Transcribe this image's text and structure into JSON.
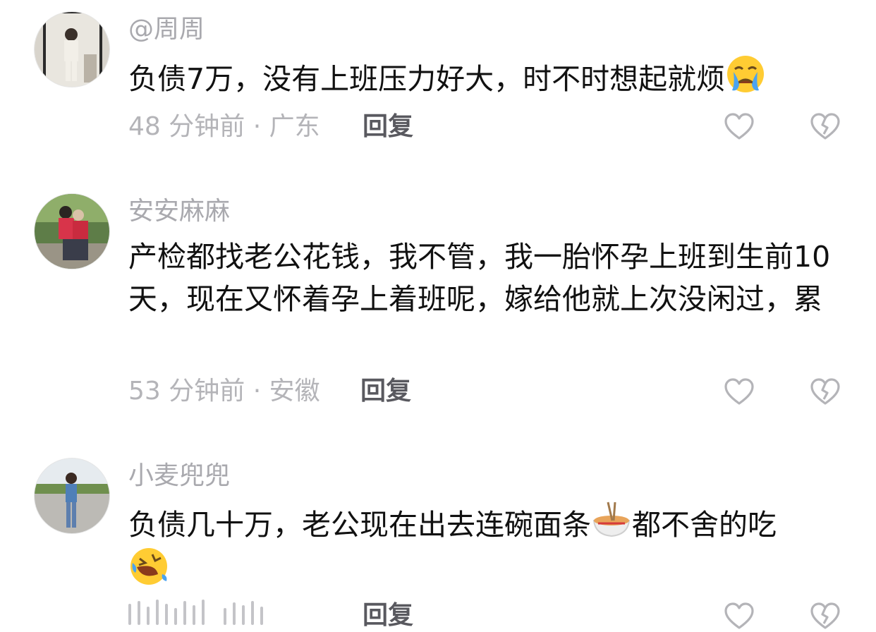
{
  "comments": [
    {
      "username": "@周周",
      "text": "负债7万，没有上班压力好大，时不时想起就烦",
      "emoji": "crying-face-icon",
      "time": "48 分钟前",
      "location": "广东",
      "reply_label": "回复"
    },
    {
      "username": "安安麻麻",
      "text": "产检都找老公花钱，我不管，我一胎怀孕上班到生前10天，现在又怀着孕上着班呢，嫁给他就上次没闲过，累",
      "time": "53 分钟前",
      "location": "安徽",
      "reply_label": "回复"
    },
    {
      "username": "小麦兜兜",
      "text_part1": "负债几十万，老公现在出去连碗面条",
      "text_part2": "都不舍的吃",
      "emoji_inline": "noodle-bowl-icon",
      "emoji_end": "rofl-face-icon",
      "reply_label": "回复"
    }
  ],
  "separator": "·",
  "colors": {
    "username": "#a9a9ae",
    "meta": "#b4b4b8",
    "reply": "#59595f",
    "text": "#111111",
    "icon_stroke": "#b4b4b8"
  }
}
